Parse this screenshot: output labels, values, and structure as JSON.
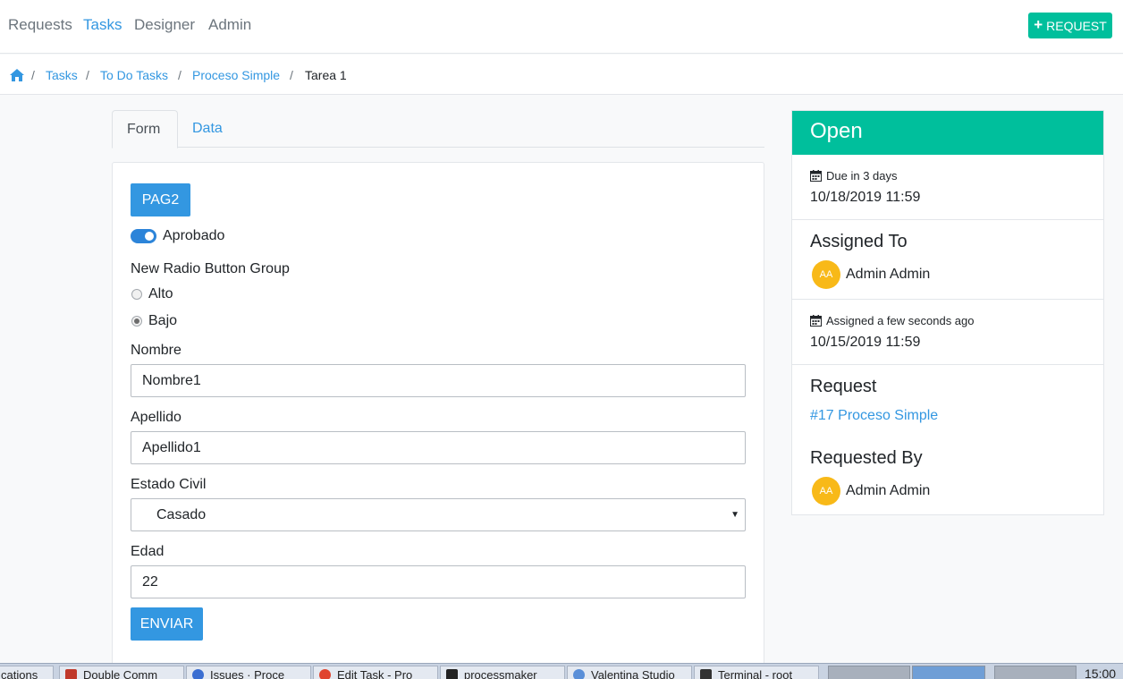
{
  "nav": {
    "items": [
      {
        "label": "Requests",
        "active": false
      },
      {
        "label": "Tasks",
        "active": true
      },
      {
        "label": "Designer",
        "active": false
      },
      {
        "label": "Admin",
        "active": false
      }
    ],
    "request_button": "REQUEST"
  },
  "breadcrumb": {
    "home_icon": "home-icon",
    "items": [
      "Tasks",
      "To Do Tasks",
      "Proceso Simple",
      "Tarea 1"
    ]
  },
  "tabs": [
    "Form",
    "Data"
  ],
  "form": {
    "page_button": "PAG2",
    "toggle": {
      "label": "Aprobado",
      "on": true
    },
    "radio_group": {
      "label": "New Radio Button Group",
      "options": [
        "Alto",
        "Bajo"
      ],
      "selected": "Bajo"
    },
    "fields": {
      "nombre": {
        "label": "Nombre",
        "value": "Nombre1"
      },
      "apellido": {
        "label": "Apellido",
        "value": "Apellido1"
      },
      "estado_civil": {
        "label": "Estado Civil",
        "value": "Casado"
      },
      "edad": {
        "label": "Edad",
        "value": "22"
      }
    },
    "submit": "ENVIAR"
  },
  "sidebar": {
    "status": "Open",
    "due": {
      "label": "Due in 3 days",
      "date": "10/18/2019 11:59"
    },
    "assigned_to": {
      "heading": "Assigned To",
      "initials": "AA",
      "name": "Admin Admin"
    },
    "assigned": {
      "label": "Assigned a few seconds ago",
      "date": "10/15/2019 11:59"
    },
    "request": {
      "heading": "Request",
      "link": "#17 Proceso Simple"
    },
    "requested_by": {
      "heading": "Requested By",
      "initials": "AA",
      "name": "Admin Admin"
    }
  },
  "taskbar": {
    "items": [
      "cations",
      "Double Comm",
      "Issues · Proce",
      "Edit Task - Pro",
      "processmaker",
      "Valentina Studio",
      "Terminal - root"
    ],
    "clock": "15:00"
  },
  "colors": {
    "primary": "#3397e1",
    "success": "#00bf9c",
    "avatar": "#f8b918"
  }
}
